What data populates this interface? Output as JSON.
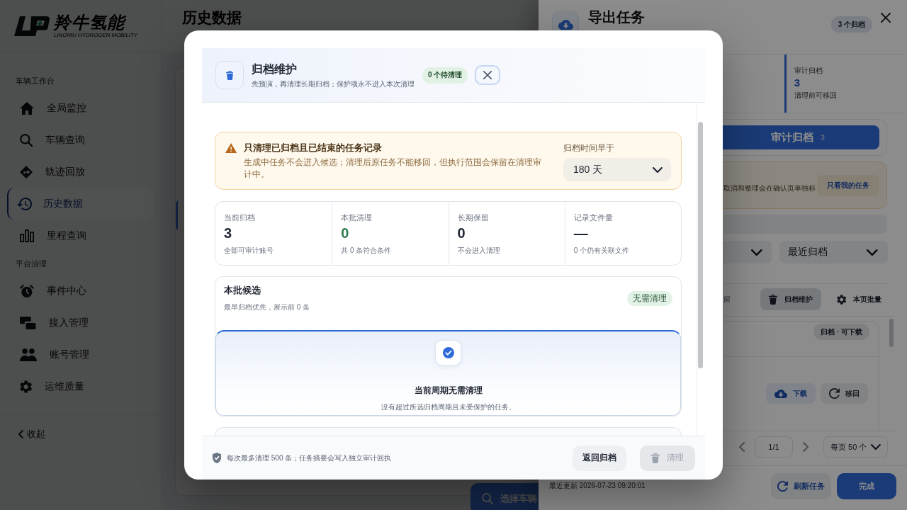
{
  "sidebar": {
    "logo": {
      "name": "羚牛氢能",
      "tagline": "LINGNIU HYDROGEN MOBILITY"
    },
    "groups": [
      {
        "label": "车辆工作台",
        "items": [
          {
            "label": "全局监控",
            "selected": false
          },
          {
            "label": "车辆查询",
            "selected": false
          },
          {
            "label": "轨迹回放",
            "selected": false
          },
          {
            "label": "历史数据",
            "selected": true
          },
          {
            "label": "里程查询",
            "selected": false
          }
        ]
      },
      {
        "label": "平台治理",
        "items": [
          {
            "label": "事件中心",
            "selected": false
          },
          {
            "label": "接入管理",
            "selected": false
          },
          {
            "label": "账号管理",
            "selected": false
          },
          {
            "label": "运维质量",
            "selected": false
          }
        ]
      }
    ],
    "collapse": "收起"
  },
  "page": {
    "title": "历史数据",
    "action": "选择车辆"
  },
  "drawer": {
    "title": "导出任务",
    "badge": "3 个归档",
    "stats": [
      {
        "label": "审计归档",
        "value": "3",
        "note": "清理前可移回",
        "selected": true
      }
    ],
    "view_tabs": [
      {
        "label": "审计归档",
        "count": "3",
        "selected": true
      }
    ],
    "notice": {
      "text": "取消和整理会在确认页单独标",
      "action": "只看我的任务"
    },
    "sort": "最近归档",
    "toolbar": [
      {
        "label": "留",
        "active": false
      },
      {
        "label": "归档维护",
        "active": true
      },
      {
        "label": "本页批量",
        "active": false
      }
    ],
    "task": {
      "status": "归档 · 可下载",
      "actions": [
        {
          "label": "下载",
          "kind": "primary"
        },
        {
          "label": "移回",
          "kind": "secondary"
        }
      ]
    },
    "pagination": {
      "page": "1/1",
      "page_size": "每页 50 个"
    },
    "updated": "最近更新 2026-07-23 09:20:01",
    "buttons": [
      {
        "label": "刷新任务",
        "kind": "secondary"
      },
      {
        "label": "完成",
        "kind": "primary"
      }
    ]
  },
  "modal": {
    "title": "归档维护",
    "subtitle": "先预演，再清理长期归档；保护项永不进入本次清理",
    "badge": "0 个待清理",
    "notice": {
      "title": "只清理已归档且已结束的任务记录",
      "text": "生成中任务不会进入候选；清理后原任务不能移回，但执行范围会保留在清理审计中。",
      "field_label": "归档时间早于",
      "field_value": "180 天"
    },
    "stats": [
      {
        "label": "当前归档",
        "value": "3",
        "note": "全部可审计账号",
        "color": "#1f2533"
      },
      {
        "label": "本批清理",
        "value": "0",
        "note": "共 0 条符合条件",
        "color": "#2e7a4e"
      },
      {
        "label": "长期保留",
        "value": "0",
        "note": "不会进入清理",
        "color": "#1f2533"
      },
      {
        "label": "记录文件量",
        "value": "—",
        "note": "0 个仍有关联文件",
        "color": "#1f2533"
      }
    ],
    "candidates": {
      "title": "本批候选",
      "subtitle": "最早归档优先，展示前 0 条",
      "badge": "无需清理",
      "empty_title": "当前周期无需清理",
      "empty_text": "没有超过所选归档周期且未受保护的任务。"
    },
    "footer_note": "每次最多清理 500 条；任务摘要会写入独立审计回执",
    "buttons": [
      {
        "label": "返回归档",
        "kind": "secondary",
        "disabled": false
      },
      {
        "label": "清理",
        "kind": "danger",
        "disabled": true
      }
    ]
  }
}
